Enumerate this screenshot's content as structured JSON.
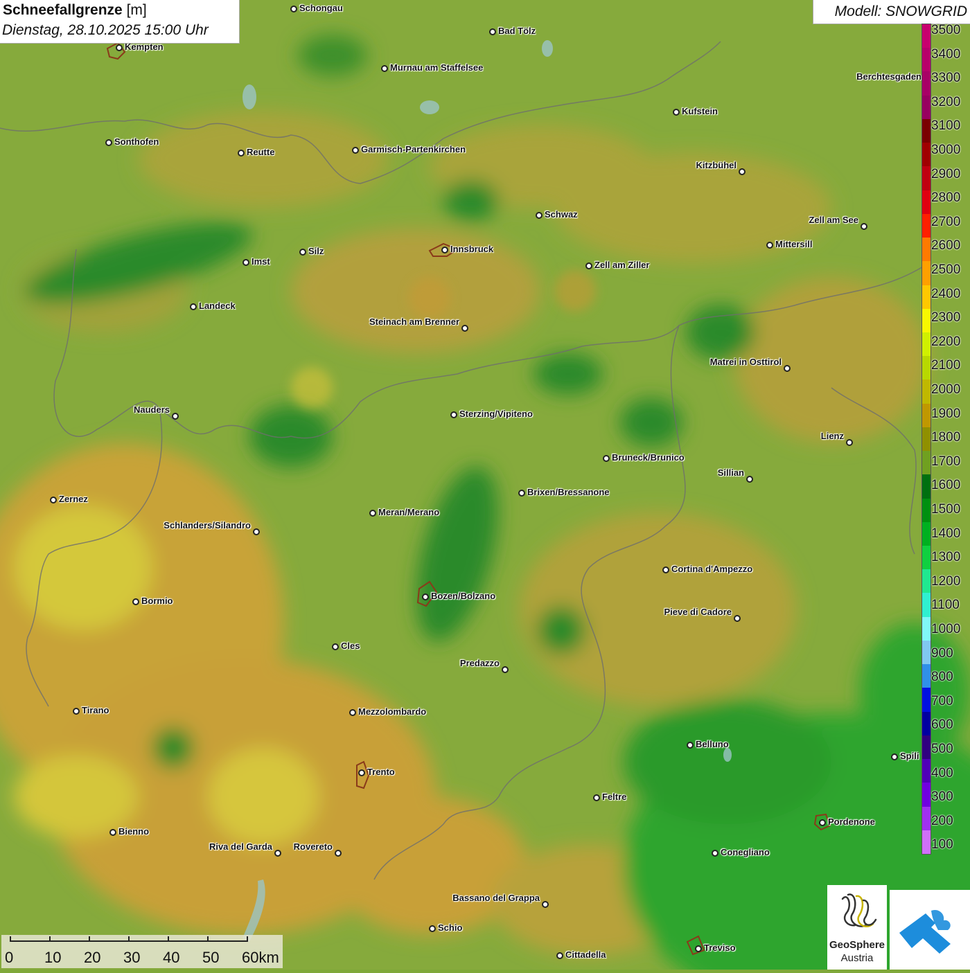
{
  "title": {
    "main": "Schneefallgrenze",
    "unit": "[m]",
    "date": "Dienstag, 28.10.2025 15:00 Uhr"
  },
  "model": "Modell: SNOWGRID",
  "legend": {
    "levels": [
      "3500",
      "3400",
      "3300",
      "3200",
      "3100",
      "3000",
      "2900",
      "2800",
      "2700",
      "2600",
      "2500",
      "2400",
      "2300",
      "2200",
      "2100",
      "2000",
      "1900",
      "1800",
      "1700",
      "1600",
      "1500",
      "1400",
      "1300",
      "1200",
      "1100",
      "1000",
      "900",
      "800",
      "700",
      "600",
      "500",
      "400",
      "300",
      "200",
      "100"
    ],
    "colors": [
      "#c8006e",
      "#b8006a",
      "#a80066",
      "#980060",
      "#7a0000",
      "#a00000",
      "#c00010",
      "#e00010",
      "#ff2000",
      "#ff7a00",
      "#ffa000",
      "#ffc800",
      "#f8f800",
      "#d0f000",
      "#b8d800",
      "#c0b800",
      "#c09800",
      "#909000",
      "#70a020",
      "#007010",
      "#009010",
      "#00b020",
      "#10d040",
      "#20e890",
      "#30f0d0",
      "#80f8f8",
      "#80c8f0",
      "#3090e8",
      "#0010e0",
      "#0000a0",
      "#300080",
      "#5000b8",
      "#7000e0",
      "#a030f0",
      "#d070f8"
    ]
  },
  "cities": [
    {
      "name": "Schongau"
    },
    {
      "name": "Bad Tölz"
    },
    {
      "name": "Kempten"
    },
    {
      "name": "Murnau am Staffelsee"
    },
    {
      "name": "Berchtesgaden"
    },
    {
      "name": "Kufstein"
    },
    {
      "name": "Sonthofen"
    },
    {
      "name": "Reutte"
    },
    {
      "name": "Garmisch-Partenkirchen"
    },
    {
      "name": "Kitzbühel"
    },
    {
      "name": "Schwaz"
    },
    {
      "name": "Zell am See"
    },
    {
      "name": "Innsbruck"
    },
    {
      "name": "Mittersill"
    },
    {
      "name": "Imst"
    },
    {
      "name": "Silz"
    },
    {
      "name": "Zell am Ziller"
    },
    {
      "name": "Landeck"
    },
    {
      "name": "Steinach am Brenner"
    },
    {
      "name": "Matrei in Osttirol"
    },
    {
      "name": "Nauders"
    },
    {
      "name": "Sterzing/Vipiteno"
    },
    {
      "name": "Lienz"
    },
    {
      "name": "Bruneck/Brunico"
    },
    {
      "name": "Sillian"
    },
    {
      "name": "Zernez"
    },
    {
      "name": "Brixen/Bressanone"
    },
    {
      "name": "Meran/Merano"
    },
    {
      "name": "Schlanders/Silandro"
    },
    {
      "name": "Cortina d'Ampezzo"
    },
    {
      "name": "Bozen/Bolzano"
    },
    {
      "name": "Bormio"
    },
    {
      "name": "Pieve di Cadore"
    },
    {
      "name": "Cles"
    },
    {
      "name": "Predazzo"
    },
    {
      "name": "Tirano"
    },
    {
      "name": "Mezzolombardo"
    },
    {
      "name": "Belluno"
    },
    {
      "name": "Trento"
    },
    {
      "name": "Feltre"
    },
    {
      "name": "Pordenone"
    },
    {
      "name": "Bienno"
    },
    {
      "name": "Riva del Garda"
    },
    {
      "name": "Rovereto"
    },
    {
      "name": "Conegliano"
    },
    {
      "name": "Bassano del Grappa"
    },
    {
      "name": "Schio"
    },
    {
      "name": "Treviso"
    },
    {
      "name": "Cittadella"
    },
    {
      "name": "Spili"
    }
  ],
  "scale": {
    "labels": [
      "0",
      "10",
      "20",
      "30",
      "40",
      "50",
      "60km"
    ]
  },
  "logo": {
    "line1": "GeoSphere",
    "line2": "Austria"
  }
}
